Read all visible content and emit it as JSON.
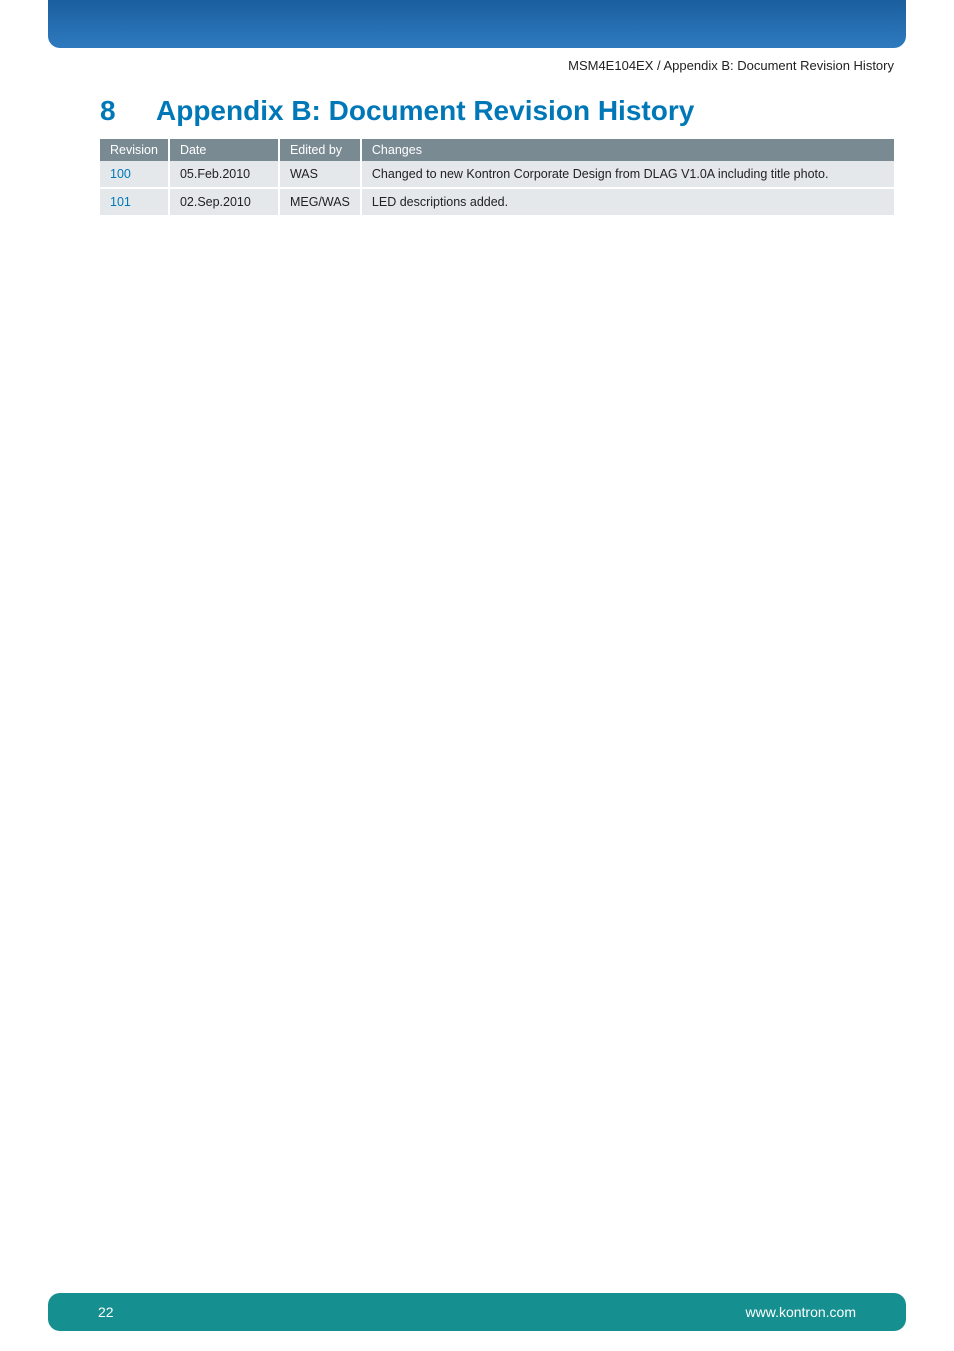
{
  "header": {
    "breadcrumb": "MSM4E104EX / Appendix B: Document Revision History"
  },
  "section": {
    "number": "8",
    "title": "Appendix B: Document Revision History"
  },
  "table": {
    "headers": {
      "revision": "Revision",
      "date": "Date",
      "edited_by": "Edited by",
      "changes": "Changes"
    },
    "rows": [
      {
        "revision": "100",
        "date": "05.Feb.2010",
        "edited_by": "WAS",
        "changes": "Changed to new Kontron Corporate Design from DLAG V1.0A including title photo."
      },
      {
        "revision": "101",
        "date": "02.Sep.2010",
        "edited_by": "MEG/WAS",
        "changes": "LED descriptions added."
      }
    ]
  },
  "footer": {
    "page_number": "22",
    "url": "www.kontron.com"
  }
}
